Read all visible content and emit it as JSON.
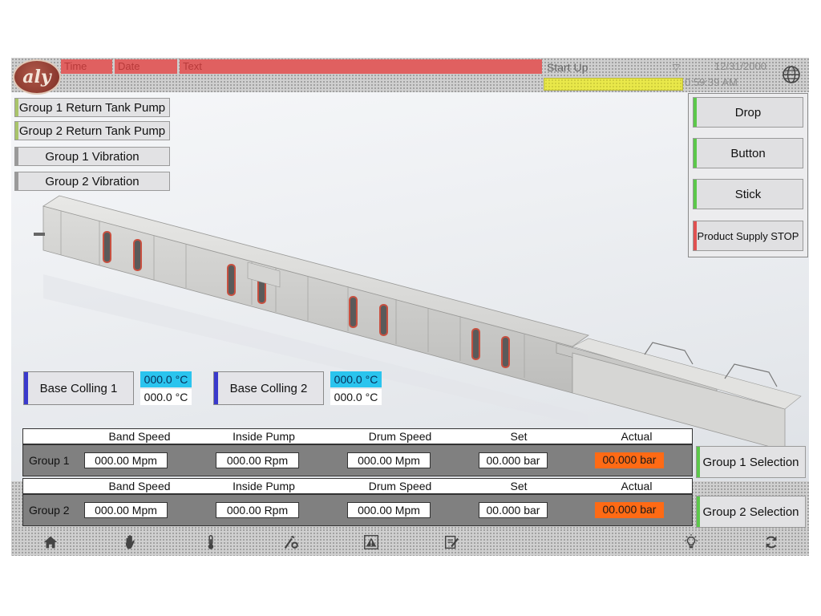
{
  "header": {
    "logo_text": "aly",
    "alarm_columns": [
      "Time",
      "Date",
      "Text"
    ],
    "mode_select": "Start Up",
    "date": "12/31/2000",
    "time": "0:59:39 AM"
  },
  "top_left_buttons": [
    {
      "label": "Group 1 Return Tank Pump",
      "indicator_color": "#a9c56a"
    },
    {
      "label": "Group 2 Return Tank Pump",
      "indicator_color": "#a9c56a"
    },
    {
      "label": "Group 1 Vibration",
      "indicator_color": "#9a9a9a"
    },
    {
      "label": "Group 2 Vibration",
      "indicator_color": "#9a9a9a"
    }
  ],
  "right_panel": [
    {
      "label": "Drop",
      "indicator_color": "#5cc84a"
    },
    {
      "label": "Button",
      "indicator_color": "#5cc84a"
    },
    {
      "label": "Stick",
      "indicator_color": "#5cc84a"
    },
    {
      "label": "Product Supply STOP",
      "indicator_color": "#e05050"
    }
  ],
  "base_colling": [
    {
      "label": "Base Colling 1",
      "setpoint": "000.0 °C",
      "actual": "000.0 °C"
    },
    {
      "label": "Base Colling 2",
      "setpoint": "000.0 °C",
      "actual": "000.0 °C"
    }
  ],
  "columns": [
    "Band Speed",
    "Inside Pump",
    "Drum Speed",
    "Set",
    "Actual"
  ],
  "groups": [
    {
      "label": "Group 1",
      "band_speed": "000.00 Mpm",
      "inside_pump": "000.00 Rpm",
      "drum_speed": "000.00 Mpm",
      "set": "00.000 bar",
      "actual": "00.000 bar",
      "selection": "Group 1 Selection"
    },
    {
      "label": "Group 2",
      "band_speed": "000.00 Mpm",
      "inside_pump": "000.00 Rpm",
      "drum_speed": "000.00 Mpm",
      "set": "00.000 bar",
      "actual": "00.000 bar",
      "selection": "Group 2 Selection"
    }
  ],
  "nav": [
    "home-icon",
    "hand-icon",
    "thermometer-icon",
    "tools-icon",
    "alarm-warning-icon",
    "notes-icon",
    "lightbulb-icon",
    "refresh-icon"
  ],
  "colors": {
    "alarm_red": "#e06060",
    "cyan_value": "#2ac4ee",
    "orange_value": "#ff6a14",
    "status_green": "#5cc84a"
  }
}
